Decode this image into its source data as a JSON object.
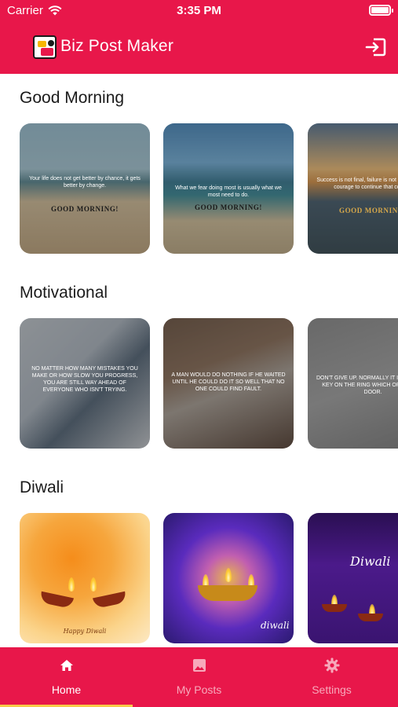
{
  "status_bar": {
    "carrier": "Carrier",
    "time": "3:35 PM"
  },
  "app_bar": {
    "title": "Biz Post Maker",
    "logout_icon": "logout-icon"
  },
  "sections": [
    {
      "title": "Good Morning",
      "cards": [
        {
          "caption": "Your life does not get better by chance, it gets better by change.",
          "label": "GOOD MORNING!"
        },
        {
          "caption": "What we fear doing most is usually what we most need to do.",
          "label": "GOOD MORNING!"
        },
        {
          "caption": "Success is not final, failure is not fatal. It is the courage to continue that counts.",
          "label": "GOOD MORNING!"
        }
      ]
    },
    {
      "title": "Motivational",
      "cards": [
        {
          "caption": "NO MATTER HOW MANY MISTAKES YOU MAKE OR HOW SLOW YOU PROGRESS, YOU ARE STILL WAY AHEAD OF EVERYONE WHO ISN'T TRYING."
        },
        {
          "caption": "A MAN WOULD DO NOTHING IF HE WAITED UNTIL HE COULD DO IT SO WELL THAT NO ONE COULD FIND FAULT."
        },
        {
          "caption": "DON'T GIVE UP. NORMALLY IT IS THE LAST KEY ON THE RING WHICH OPENS THE DOOR."
        }
      ]
    },
    {
      "title": "Diwali",
      "cards": [
        {
          "caption": "Happy Diwali"
        },
        {
          "caption": "diwali"
        },
        {
          "caption": "Diwali"
        }
      ]
    }
  ],
  "tabs": [
    {
      "label": "Home",
      "icon": "home-icon",
      "active": true
    },
    {
      "label": "My Posts",
      "icon": "image-icon",
      "active": false
    },
    {
      "label": "Settings",
      "icon": "gear-icon",
      "active": false
    }
  ],
  "colors": {
    "primary": "#e8174a",
    "tab_inactive": "#f7a9bb",
    "indicator": "#f7c948"
  }
}
